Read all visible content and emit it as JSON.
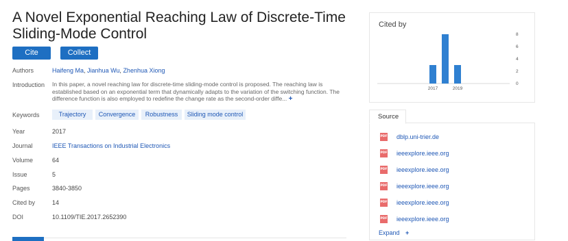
{
  "paper": {
    "title": "A Novel Exponential Reaching Law of Discrete-Time Sliding-Mode Control",
    "cite_label": "Cite",
    "collect_label": "Collect",
    "authors_label": "Authors",
    "authors": [
      "Haifeng Ma",
      "Jianhua Wu",
      "Zhenhua Xiong"
    ],
    "intro_label": "Introduction",
    "intro_text": "In this paper, a novel reaching law for discrete-time sliding-mode control is proposed. The reaching law is established based on an exponential term that dynamically adapts to the variation of the switching function. The difference function is also employed to redefine the change rate as the second-order diffe...",
    "intro_more": "+",
    "keywords_label": "Keywords",
    "keywords": [
      "Trajectory",
      "Convergence",
      "Robustness",
      "Sliding mode control"
    ],
    "year_label": "Year",
    "year": "2017",
    "journal_label": "Journal",
    "journal": "IEEE Transactions on Industrial Electronics",
    "volume_label": "Volume",
    "volume": "64",
    "issue_label": "Issue",
    "issue": "5",
    "pages_label": "Pages",
    "pages": "3840-3850",
    "citedby_label": "Cited by",
    "citedby": "14",
    "doi_label": "DOI",
    "doi": "10.1109/TIE.2017.2652390"
  },
  "cited_panel": {
    "title": "Cited by"
  },
  "chart_data": {
    "type": "bar",
    "categories": [
      "2017",
      "2018",
      "2019"
    ],
    "values": [
      3,
      8,
      3
    ],
    "x_tick_labels": [
      "2017",
      "2019"
    ],
    "y_ticks": [
      "0",
      "2",
      "4",
      "6",
      "8"
    ],
    "ylim": [
      0,
      8
    ],
    "bar_color": "#2f80d1",
    "grid": false
  },
  "source_panel": {
    "tab_label": "Source",
    "items": [
      {
        "icon": "pdf-icon",
        "icon_text": "PDF",
        "label": "dblp.uni-trier.de"
      },
      {
        "icon": "pdf-icon",
        "icon_text": "PDF",
        "label": "ieeexplore.ieee.org"
      },
      {
        "icon": "pdf-icon",
        "icon_text": "PDF",
        "label": "ieeexplore.ieee.org"
      },
      {
        "icon": "pdf-icon",
        "icon_text": "PDF",
        "label": "ieeexplore.ieee.org"
      },
      {
        "icon": "pdf-icon",
        "icon_text": "PDF",
        "label": "ieeexplore.ieee.org"
      },
      {
        "icon": "pdf-icon",
        "icon_text": "PDF",
        "label": "ieeexplore.ieee.org"
      }
    ],
    "expand_label": "Expand",
    "expand_plus": "+"
  },
  "colors": {
    "accent": "#1e6fc2",
    "link": "#1e57b5",
    "keyword_bg": "#e8f0fa",
    "pdf_icon": "#e96b6b"
  }
}
